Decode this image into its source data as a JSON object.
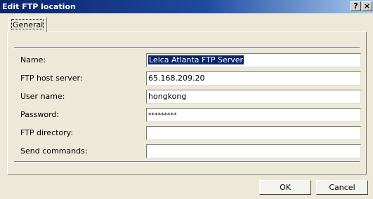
{
  "window": {
    "title": "Edit FTP location",
    "help_label": "?",
    "close_label": "×"
  },
  "tabs": [
    {
      "label": "General",
      "selected": true
    }
  ],
  "fields": {
    "name": {
      "label": "Name:",
      "value": "Leica Atlanta FTP Server",
      "selected": true
    },
    "host": {
      "label": "FTP host server:",
      "value": "65.168.209.20"
    },
    "user": {
      "label": "User name:",
      "value": "hongkong"
    },
    "password": {
      "label": "Password:",
      "value": "*********"
    },
    "directory": {
      "label": "FTP directory:",
      "value": ""
    },
    "commands": {
      "label": "Send commands:",
      "value": ""
    }
  },
  "buttons": {
    "ok_label": "OK",
    "cancel_label": "Cancel"
  },
  "colors": {
    "titlebar_start": "#0a246a",
    "titlebar_end": "#a6caf0",
    "selection": "#0a246a",
    "dialog_bg": "#ece9d8"
  }
}
